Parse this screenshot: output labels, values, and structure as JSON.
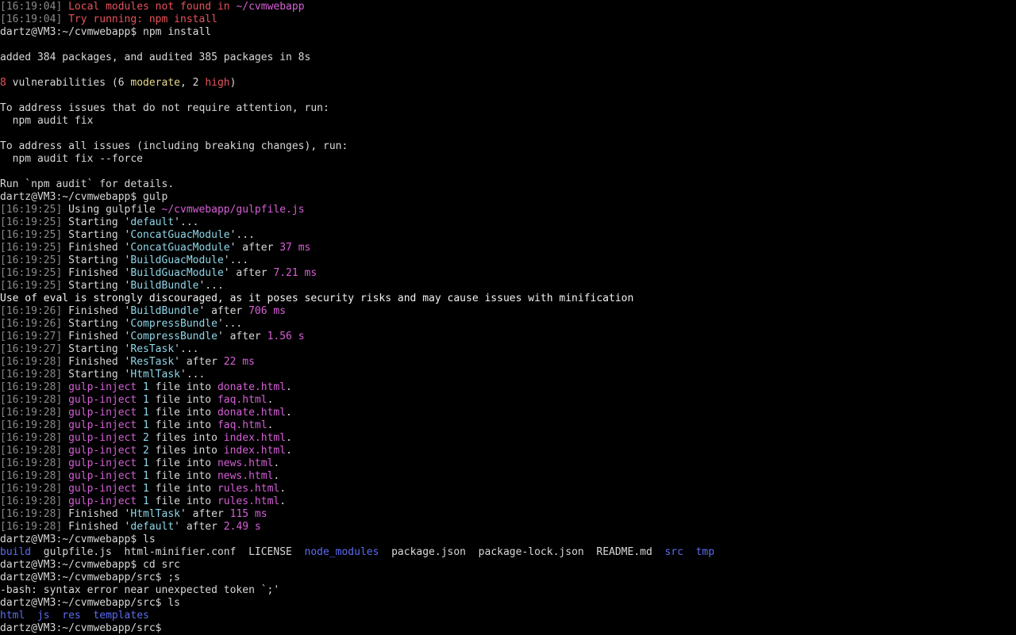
{
  "terminal": {
    "prompt_user": "dartz@VM3",
    "colors": {
      "background": "#000000",
      "text": "#d8d8d8",
      "timestamp": "#8a8a8a",
      "red": "#e8525c",
      "magenta": "#d65fd6",
      "cyan": "#8fd6e8",
      "yellow": "#e8d98a",
      "directory_blue": "#5c6cf0"
    },
    "lines": [
      {
        "type": "log",
        "segments": [
          {
            "t": "[16:19:04]",
            "c": "ts"
          },
          {
            "t": " ",
            "c": "text"
          },
          {
            "t": "Local modules not found in ",
            "c": "red"
          },
          {
            "t": "~/cvmwebapp",
            "c": "magenta"
          }
        ]
      },
      {
        "type": "log",
        "segments": [
          {
            "t": "[16:19:04]",
            "c": "ts"
          },
          {
            "t": " ",
            "c": "text"
          },
          {
            "t": "Try running: npm install",
            "c": "red"
          }
        ]
      },
      {
        "type": "command",
        "segments": [
          {
            "t": "dartz@VM3:~/cvmwebapp$ npm install",
            "c": "text"
          }
        ]
      },
      {
        "type": "blank",
        "segments": []
      },
      {
        "type": "output",
        "segments": [
          {
            "t": "added 384 packages, and audited 385 packages in 8s",
            "c": "text"
          }
        ]
      },
      {
        "type": "blank",
        "segments": []
      },
      {
        "type": "output",
        "segments": [
          {
            "t": "8",
            "c": "red"
          },
          {
            "t": " vulnerabilities (6 ",
            "c": "text"
          },
          {
            "t": "moderate",
            "c": "yellow"
          },
          {
            "t": ", 2 ",
            "c": "text"
          },
          {
            "t": "high",
            "c": "red"
          },
          {
            "t": ")",
            "c": "text"
          }
        ]
      },
      {
        "type": "blank",
        "segments": []
      },
      {
        "type": "output",
        "segments": [
          {
            "t": "To address issues that do not require attention, run:",
            "c": "text"
          }
        ]
      },
      {
        "type": "output",
        "segments": [
          {
            "t": "  npm audit fix",
            "c": "text"
          }
        ]
      },
      {
        "type": "blank",
        "segments": []
      },
      {
        "type": "output",
        "segments": [
          {
            "t": "To address all issues (including breaking changes), run:",
            "c": "text"
          }
        ]
      },
      {
        "type": "output",
        "segments": [
          {
            "t": "  npm audit fix --force",
            "c": "text"
          }
        ]
      },
      {
        "type": "blank",
        "segments": []
      },
      {
        "type": "output",
        "segments": [
          {
            "t": "Run `npm audit` for details.",
            "c": "text"
          }
        ]
      },
      {
        "type": "command",
        "segments": [
          {
            "t": "dartz@VM3:~/cvmwebapp$ gulp",
            "c": "text"
          }
        ]
      },
      {
        "type": "log",
        "segments": [
          {
            "t": "[16:19:25]",
            "c": "ts"
          },
          {
            "t": " Using gulpfile ",
            "c": "text"
          },
          {
            "t": "~/cvmwebapp/gulpfile.js",
            "c": "magenta"
          }
        ]
      },
      {
        "type": "log",
        "segments": [
          {
            "t": "[16:19:25]",
            "c": "ts"
          },
          {
            "t": " Starting '",
            "c": "text"
          },
          {
            "t": "default",
            "c": "cyan"
          },
          {
            "t": "'...",
            "c": "text"
          }
        ]
      },
      {
        "type": "log",
        "segments": [
          {
            "t": "[16:19:25]",
            "c": "ts"
          },
          {
            "t": " Starting '",
            "c": "text"
          },
          {
            "t": "ConcatGuacModule",
            "c": "cyan"
          },
          {
            "t": "'...",
            "c": "text"
          }
        ]
      },
      {
        "type": "log",
        "segments": [
          {
            "t": "[16:19:25]",
            "c": "ts"
          },
          {
            "t": " Finished '",
            "c": "text"
          },
          {
            "t": "ConcatGuacModule",
            "c": "cyan"
          },
          {
            "t": "' after ",
            "c": "text"
          },
          {
            "t": "37 ms",
            "c": "magenta"
          }
        ]
      },
      {
        "type": "log",
        "segments": [
          {
            "t": "[16:19:25]",
            "c": "ts"
          },
          {
            "t": " Starting '",
            "c": "text"
          },
          {
            "t": "BuildGuacModule",
            "c": "cyan"
          },
          {
            "t": "'...",
            "c": "text"
          }
        ]
      },
      {
        "type": "log",
        "segments": [
          {
            "t": "[16:19:25]",
            "c": "ts"
          },
          {
            "t": " Finished '",
            "c": "text"
          },
          {
            "t": "BuildGuacModule",
            "c": "cyan"
          },
          {
            "t": "' after ",
            "c": "text"
          },
          {
            "t": "7.21 ms",
            "c": "magenta"
          }
        ]
      },
      {
        "type": "log",
        "segments": [
          {
            "t": "[16:19:25]",
            "c": "ts"
          },
          {
            "t": " Starting '",
            "c": "text"
          },
          {
            "t": "BuildBundle",
            "c": "cyan"
          },
          {
            "t": "'...",
            "c": "text"
          }
        ]
      },
      {
        "type": "output",
        "segments": [
          {
            "t": "Use of eval is strongly discouraged, as it poses security risks and may cause issues with minification",
            "c": "white"
          }
        ]
      },
      {
        "type": "log",
        "segments": [
          {
            "t": "[16:19:26]",
            "c": "ts"
          },
          {
            "t": " Finished '",
            "c": "text"
          },
          {
            "t": "BuildBundle",
            "c": "cyan"
          },
          {
            "t": "' after ",
            "c": "text"
          },
          {
            "t": "706 ms",
            "c": "magenta"
          }
        ]
      },
      {
        "type": "log",
        "segments": [
          {
            "t": "[16:19:26]",
            "c": "ts"
          },
          {
            "t": " Starting '",
            "c": "text"
          },
          {
            "t": "CompressBundle",
            "c": "cyan"
          },
          {
            "t": "'...",
            "c": "text"
          }
        ]
      },
      {
        "type": "log",
        "segments": [
          {
            "t": "[16:19:27]",
            "c": "ts"
          },
          {
            "t": " Finished '",
            "c": "text"
          },
          {
            "t": "CompressBundle",
            "c": "cyan"
          },
          {
            "t": "' after ",
            "c": "text"
          },
          {
            "t": "1.56 s",
            "c": "magenta"
          }
        ]
      },
      {
        "type": "log",
        "segments": [
          {
            "t": "[16:19:27]",
            "c": "ts"
          },
          {
            "t": " Starting '",
            "c": "text"
          },
          {
            "t": "ResTask",
            "c": "cyan"
          },
          {
            "t": "'...",
            "c": "text"
          }
        ]
      },
      {
        "type": "log",
        "segments": [
          {
            "t": "[16:19:28]",
            "c": "ts"
          },
          {
            "t": " Finished '",
            "c": "text"
          },
          {
            "t": "ResTask",
            "c": "cyan"
          },
          {
            "t": "' after ",
            "c": "text"
          },
          {
            "t": "22 ms",
            "c": "magenta"
          }
        ]
      },
      {
        "type": "log",
        "segments": [
          {
            "t": "[16:19:28]",
            "c": "ts"
          },
          {
            "t": " Starting '",
            "c": "text"
          },
          {
            "t": "HtmlTask",
            "c": "cyan"
          },
          {
            "t": "'...",
            "c": "text"
          }
        ]
      },
      {
        "type": "log",
        "segments": [
          {
            "t": "[16:19:28]",
            "c": "ts"
          },
          {
            "t": " ",
            "c": "text"
          },
          {
            "t": "gulp-inject",
            "c": "magenta"
          },
          {
            "t": " ",
            "c": "text"
          },
          {
            "t": "1",
            "c": "cyan"
          },
          {
            "t": " file into ",
            "c": "text"
          },
          {
            "t": "donate.html",
            "c": "magenta"
          },
          {
            "t": ".",
            "c": "text"
          }
        ]
      },
      {
        "type": "log",
        "segments": [
          {
            "t": "[16:19:28]",
            "c": "ts"
          },
          {
            "t": " ",
            "c": "text"
          },
          {
            "t": "gulp-inject",
            "c": "magenta"
          },
          {
            "t": " ",
            "c": "text"
          },
          {
            "t": "1",
            "c": "cyan"
          },
          {
            "t": " file into ",
            "c": "text"
          },
          {
            "t": "faq.html",
            "c": "magenta"
          },
          {
            "t": ".",
            "c": "text"
          }
        ]
      },
      {
        "type": "log",
        "segments": [
          {
            "t": "[16:19:28]",
            "c": "ts"
          },
          {
            "t": " ",
            "c": "text"
          },
          {
            "t": "gulp-inject",
            "c": "magenta"
          },
          {
            "t": " ",
            "c": "text"
          },
          {
            "t": "1",
            "c": "cyan"
          },
          {
            "t": " file into ",
            "c": "text"
          },
          {
            "t": "donate.html",
            "c": "magenta"
          },
          {
            "t": ".",
            "c": "text"
          }
        ]
      },
      {
        "type": "log",
        "segments": [
          {
            "t": "[16:19:28]",
            "c": "ts"
          },
          {
            "t": " ",
            "c": "text"
          },
          {
            "t": "gulp-inject",
            "c": "magenta"
          },
          {
            "t": " ",
            "c": "text"
          },
          {
            "t": "1",
            "c": "cyan"
          },
          {
            "t": " file into ",
            "c": "text"
          },
          {
            "t": "faq.html",
            "c": "magenta"
          },
          {
            "t": ".",
            "c": "text"
          }
        ]
      },
      {
        "type": "log",
        "segments": [
          {
            "t": "[16:19:28]",
            "c": "ts"
          },
          {
            "t": " ",
            "c": "text"
          },
          {
            "t": "gulp-inject",
            "c": "magenta"
          },
          {
            "t": " ",
            "c": "text"
          },
          {
            "t": "2",
            "c": "cyan"
          },
          {
            "t": " files into ",
            "c": "text"
          },
          {
            "t": "index.html",
            "c": "magenta"
          },
          {
            "t": ".",
            "c": "text"
          }
        ]
      },
      {
        "type": "log",
        "segments": [
          {
            "t": "[16:19:28]",
            "c": "ts"
          },
          {
            "t": " ",
            "c": "text"
          },
          {
            "t": "gulp-inject",
            "c": "magenta"
          },
          {
            "t": " ",
            "c": "text"
          },
          {
            "t": "2",
            "c": "cyan"
          },
          {
            "t": " files into ",
            "c": "text"
          },
          {
            "t": "index.html",
            "c": "magenta"
          },
          {
            "t": ".",
            "c": "text"
          }
        ]
      },
      {
        "type": "log",
        "segments": [
          {
            "t": "[16:19:28]",
            "c": "ts"
          },
          {
            "t": " ",
            "c": "text"
          },
          {
            "t": "gulp-inject",
            "c": "magenta"
          },
          {
            "t": " ",
            "c": "text"
          },
          {
            "t": "1",
            "c": "cyan"
          },
          {
            "t": " file into ",
            "c": "text"
          },
          {
            "t": "news.html",
            "c": "magenta"
          },
          {
            "t": ".",
            "c": "text"
          }
        ]
      },
      {
        "type": "log",
        "segments": [
          {
            "t": "[16:19:28]",
            "c": "ts"
          },
          {
            "t": " ",
            "c": "text"
          },
          {
            "t": "gulp-inject",
            "c": "magenta"
          },
          {
            "t": " ",
            "c": "text"
          },
          {
            "t": "1",
            "c": "cyan"
          },
          {
            "t": " file into ",
            "c": "text"
          },
          {
            "t": "news.html",
            "c": "magenta"
          },
          {
            "t": ".",
            "c": "text"
          }
        ]
      },
      {
        "type": "log",
        "segments": [
          {
            "t": "[16:19:28]",
            "c": "ts"
          },
          {
            "t": " ",
            "c": "text"
          },
          {
            "t": "gulp-inject",
            "c": "magenta"
          },
          {
            "t": " ",
            "c": "text"
          },
          {
            "t": "1",
            "c": "cyan"
          },
          {
            "t": " file into ",
            "c": "text"
          },
          {
            "t": "rules.html",
            "c": "magenta"
          },
          {
            "t": ".",
            "c": "text"
          }
        ]
      },
      {
        "type": "log",
        "segments": [
          {
            "t": "[16:19:28]",
            "c": "ts"
          },
          {
            "t": " ",
            "c": "text"
          },
          {
            "t": "gulp-inject",
            "c": "magenta"
          },
          {
            "t": " ",
            "c": "text"
          },
          {
            "t": "1",
            "c": "cyan"
          },
          {
            "t": " file into ",
            "c": "text"
          },
          {
            "t": "rules.html",
            "c": "magenta"
          },
          {
            "t": ".",
            "c": "text"
          }
        ]
      },
      {
        "type": "log",
        "segments": [
          {
            "t": "[16:19:28]",
            "c": "ts"
          },
          {
            "t": " Finished '",
            "c": "text"
          },
          {
            "t": "HtmlTask",
            "c": "cyan"
          },
          {
            "t": "' after ",
            "c": "text"
          },
          {
            "t": "115 ms",
            "c": "magenta"
          }
        ]
      },
      {
        "type": "log",
        "segments": [
          {
            "t": "[16:19:28]",
            "c": "ts"
          },
          {
            "t": " Finished '",
            "c": "text"
          },
          {
            "t": "default",
            "c": "cyan"
          },
          {
            "t": "' after ",
            "c": "text"
          },
          {
            "t": "2.49 s",
            "c": "magenta"
          }
        ]
      },
      {
        "type": "command",
        "segments": [
          {
            "t": "dartz@VM3:~/cvmwebapp$ ls",
            "c": "text"
          }
        ]
      },
      {
        "type": "listing",
        "segments": [
          {
            "t": "build",
            "c": "blue"
          },
          {
            "t": "  gulpfile.js  html-minifier.conf  LICENSE  ",
            "c": "text"
          },
          {
            "t": "node_modules",
            "c": "blue"
          },
          {
            "t": "  package.json  package-lock.json  README.md  ",
            "c": "text"
          },
          {
            "t": "src",
            "c": "blue"
          },
          {
            "t": "  ",
            "c": "text"
          },
          {
            "t": "tmp",
            "c": "blue"
          }
        ]
      },
      {
        "type": "command",
        "segments": [
          {
            "t": "dartz@VM3:~/cvmwebapp$ cd src",
            "c": "text"
          }
        ]
      },
      {
        "type": "command",
        "segments": [
          {
            "t": "dartz@VM3:~/cvmwebapp/src$ ;s",
            "c": "text"
          }
        ]
      },
      {
        "type": "output",
        "segments": [
          {
            "t": "-bash: syntax error near unexpected token `;'",
            "c": "text"
          }
        ]
      },
      {
        "type": "command",
        "segments": [
          {
            "t": "dartz@VM3:~/cvmwebapp/src$ ls",
            "c": "text"
          }
        ]
      },
      {
        "type": "listing",
        "segments": [
          {
            "t": "html",
            "c": "blue"
          },
          {
            "t": "  ",
            "c": "text"
          },
          {
            "t": "js",
            "c": "blue"
          },
          {
            "t": "  ",
            "c": "text"
          },
          {
            "t": "res",
            "c": "blue"
          },
          {
            "t": "  ",
            "c": "text"
          },
          {
            "t": "templates",
            "c": "blue"
          }
        ]
      },
      {
        "type": "prompt",
        "segments": [
          {
            "t": "dartz@VM3:~/cvmwebapp/src$",
            "c": "text"
          }
        ]
      }
    ]
  }
}
